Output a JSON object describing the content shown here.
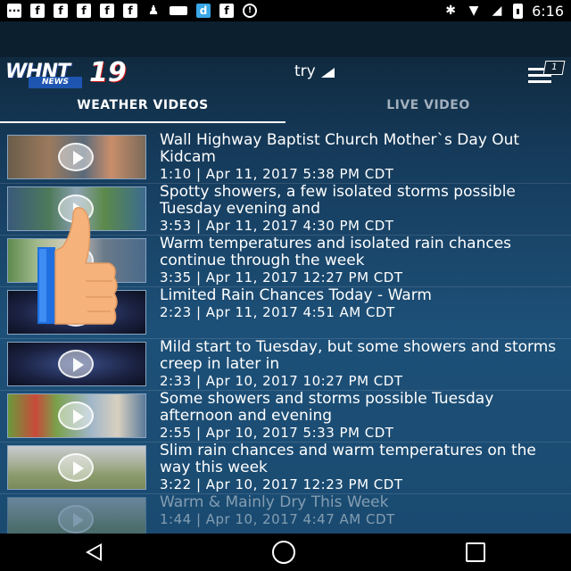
{
  "status_bar": {
    "time": "6:16",
    "left_icons": [
      "message-icon",
      "facebook-icon",
      "facebook-icon",
      "facebook-icon",
      "facebook-icon",
      "facebook-icon",
      "pawn-icon",
      "card-icon",
      "app-d-icon",
      "facebook-icon",
      "circle-icon"
    ],
    "right_icons": [
      "bluetooth-icon",
      "wifi-icon",
      "signal-icon",
      "battery-icon"
    ]
  },
  "header": {
    "logo_text": "WHNT",
    "logo_sub": "NEWS",
    "logo_number": "19",
    "market": "try",
    "menu_badge": "1"
  },
  "tabs": [
    {
      "label": "WEATHER VIDEOS",
      "active": true
    },
    {
      "label": "LIVE VIDEO",
      "active": false
    }
  ],
  "videos": [
    {
      "title": "Wall Highway Baptist Church Mother`s Day Out Kidcam",
      "meta": "1:10 | Apr 11, 2017 5:38 PM CDT"
    },
    {
      "title": "Spotty showers, a few isolated storms possible Tuesday evening and",
      "meta": "3:53 | Apr 11, 2017 4:30 PM CDT"
    },
    {
      "title": "Warm temperatures and isolated rain chances continue through the week",
      "meta": "3:35 | Apr 11, 2017 12:27 PM CDT"
    },
    {
      "title": "Limited Rain Chances Today - Warm",
      "meta": "2:23 | Apr 11, 2017 4:51 AM CDT"
    },
    {
      "title": "Mild start to Tuesday, but some showers and storms creep in later in",
      "meta": "2:33 | Apr 10, 2017 10:27 PM CDT"
    },
    {
      "title": "Some showers and storms possible Tuesday afternoon and evening",
      "meta": "2:55 | Apr 10, 2017 5:33 PM CDT"
    },
    {
      "title": "Slim rain chances and warm temperatures on the way this week",
      "meta": "3:22 | Apr 10, 2017 12:23 PM CDT"
    },
    {
      "title": "Warm & Mainly Dry This Week",
      "meta": "1:44 | Apr 10, 2017 4:47 AM CDT"
    }
  ],
  "colors": {
    "background_top": "#0e2435",
    "background_mid": "#1d5078",
    "tab_inactive": "#a3b0bd"
  }
}
